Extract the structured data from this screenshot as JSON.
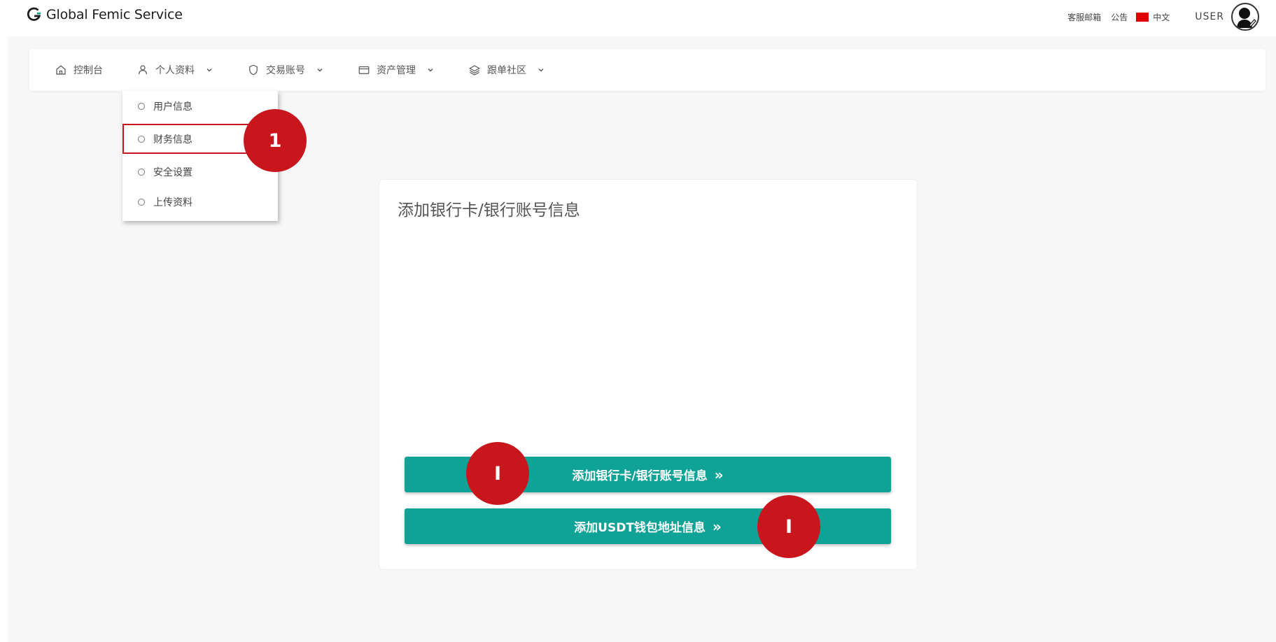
{
  "app": {
    "brand": "Global Femic Service"
  },
  "topbar": {
    "support_mail": "客服邮箱",
    "notice": "公告",
    "language": "中文",
    "user": "USER"
  },
  "nav": {
    "items": [
      {
        "label": "控制台",
        "icon": "home-icon"
      },
      {
        "label": "个人资料",
        "icon": "user-icon"
      },
      {
        "label": "交易账号",
        "icon": "shield-icon"
      },
      {
        "label": "资产管理",
        "icon": "card-icon"
      },
      {
        "label": "跟单社区",
        "icon": "layers-icon"
      }
    ]
  },
  "dropdown": {
    "items": [
      "用户信息",
      "财务信息",
      "安全设置",
      "上传资料"
    ],
    "selected": "财务信息"
  },
  "card": {
    "title": "添加银行卡/银行账号信息",
    "bank_button": "添加银行卡/银行账号信息",
    "usdt_button": "添加USDT钱包地址信息",
    "arrow": "»"
  },
  "annotations": {
    "marker1": "1",
    "marker2": "I",
    "marker3": "I"
  },
  "colors": {
    "accent": "#0fa296",
    "marker": "#c8161c",
    "flag": "#e00000"
  }
}
